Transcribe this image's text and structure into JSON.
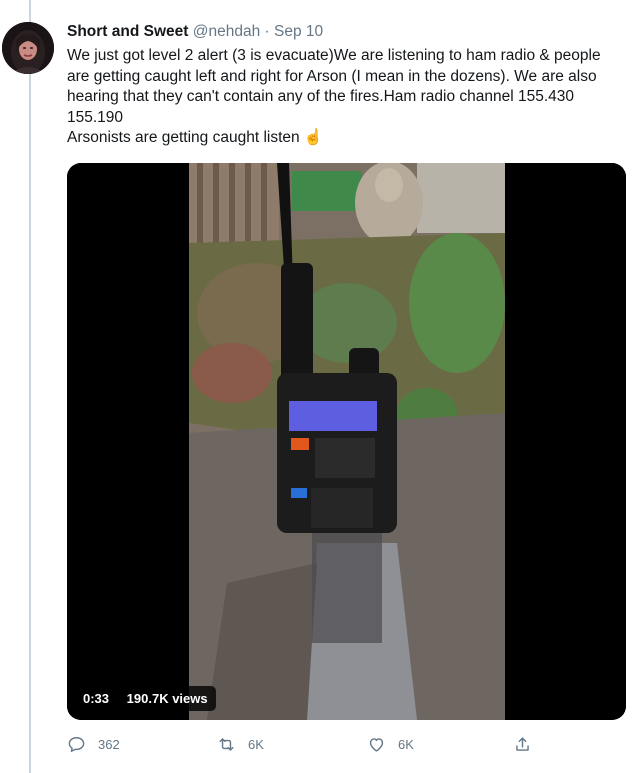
{
  "tweet": {
    "display_name": "Short and Sweet",
    "handle": "@nehdah",
    "separator": "·",
    "date": "Sep 10",
    "text_lines": [
      "We just got level 2 alert (3 is evacuate)We are listening to ham radio & people are getting caught left and right for Arson (I mean in the dozens). We are also hearing that they can't contain any of the fires.Ham radio channel 155.430 155.190",
      "Arsonists are getting caught listen ☝️"
    ]
  },
  "media": {
    "duration": "0:33",
    "views": "190.7K views"
  },
  "actions": {
    "reply_count": "362",
    "retweet_count": "6K",
    "like_count": "6K",
    "reply_icon": "reply-icon",
    "retweet_icon": "retweet-icon",
    "like_icon": "heart-icon",
    "share_icon": "share-icon"
  },
  "colors": {
    "text": "#14171a",
    "secondary": "#657786",
    "thread_line": "#ccd6dd",
    "media_background": "#000000"
  }
}
